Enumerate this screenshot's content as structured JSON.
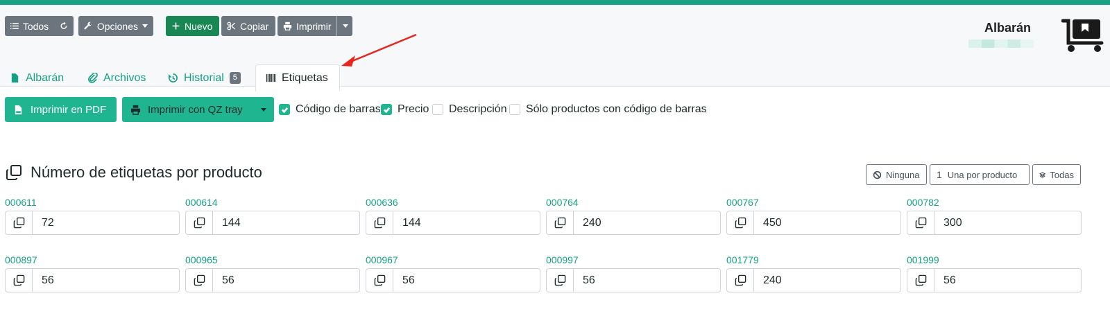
{
  "colors": {
    "accent": "#1aa383",
    "primary_green": "#1fb590",
    "link": "#16a085",
    "gray_button": "#6c757d"
  },
  "toolbar": {
    "todos_label": "Todos",
    "opciones_label": "Opciones",
    "nuevo_label": "Nuevo",
    "copiar_label": "Copiar",
    "imprimir_label": "Imprimir"
  },
  "doc": {
    "title": "Albarán"
  },
  "tabs": [
    {
      "label": "Albarán",
      "icon": "file-icon"
    },
    {
      "label": "Archivos",
      "icon": "paperclip-icon"
    },
    {
      "label": "Historial",
      "icon": "history-icon",
      "badge": "5"
    },
    {
      "label": "Etiquetas",
      "icon": "barcode-icon",
      "active": true
    }
  ],
  "actions": {
    "pdf_label": "Imprimir en PDF",
    "qz_label": "Imprimir con QZ tray"
  },
  "options": [
    {
      "label": "Código de barras",
      "checked": true
    },
    {
      "label": "Precio",
      "checked": true
    },
    {
      "label": "Descripción",
      "checked": false
    },
    {
      "label": "Sólo productos con código de barras",
      "checked": false
    }
  ],
  "section": {
    "title": "Número de etiquetas por producto"
  },
  "quantity_buttons": {
    "ninguna": "Ninguna",
    "una_por_producto": "Una por producto",
    "todas": "Todas",
    "one_glyph": "1"
  },
  "products": [
    {
      "code": "000611",
      "qty": "72"
    },
    {
      "code": "000614",
      "qty": "144"
    },
    {
      "code": "000636",
      "qty": "144"
    },
    {
      "code": "000764",
      "qty": "240"
    },
    {
      "code": "000767",
      "qty": "450"
    },
    {
      "code": "000782",
      "qty": "300"
    },
    {
      "code": "000897",
      "qty": "56"
    },
    {
      "code": "000965",
      "qty": "56"
    },
    {
      "code": "000967",
      "qty": "56"
    },
    {
      "code": "000997",
      "qty": "56"
    },
    {
      "code": "001779",
      "qty": "240"
    },
    {
      "code": "001999",
      "qty": "56"
    }
  ]
}
